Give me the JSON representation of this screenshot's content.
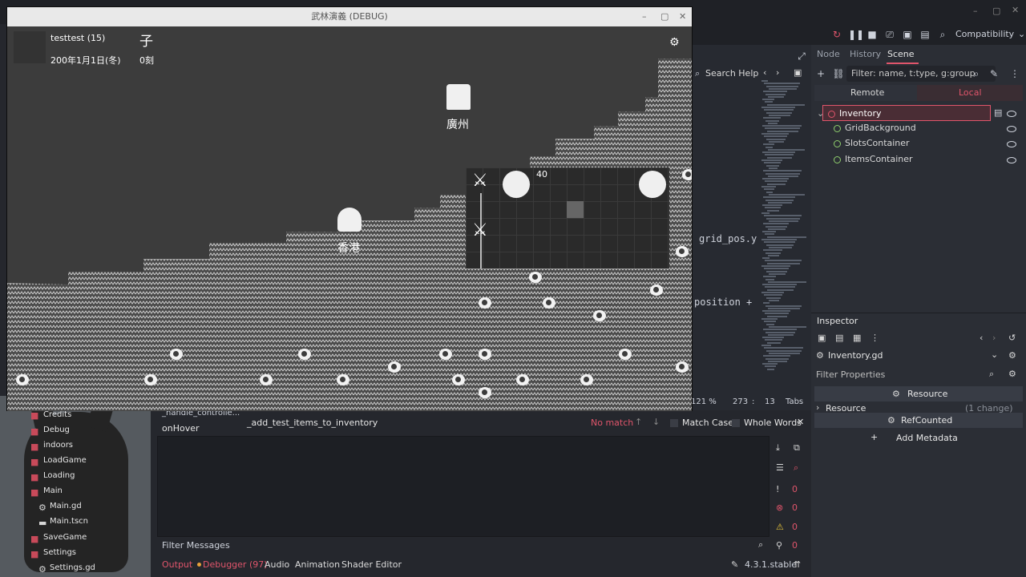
{
  "game": {
    "title": "武林演義 (DEBUG)",
    "player_name": "testtest (15)",
    "date_text": "200年1月1日(冬)",
    "hour_char": "子",
    "time_text": "0刻",
    "city_guangzhou": "廣州",
    "city_hongkong": "香港",
    "stack_count": "40"
  },
  "editor": {
    "compatibility": "Compatibility",
    "search_help": "Search Help",
    "code_line_1": "grid_pos.y",
    "code_line_2": "position +",
    "zoom": "121 %",
    "line": "273",
    "col": "13",
    "tabs": "Tabs",
    "version": "4.3.1.stable"
  },
  "scene_dock": {
    "tabs": [
      "Node",
      "History",
      "Scene"
    ],
    "filter_placeholder": "Filter: name, t:type, g:group",
    "remote": "Remote",
    "local": "Local",
    "nodes": [
      "Inventory",
      "GridBackground",
      "SlotsContainer",
      "ItemsContainer"
    ]
  },
  "inspector": {
    "title": "Inspector",
    "resource_file": "Inventory.gd",
    "filter_placeholder": "Filter Properties",
    "resource_header": "Resource",
    "resource_row": "Resource",
    "resource_change": "(1 change)",
    "refcounted": "RefCounted",
    "add_metadata": "Add Metadata"
  },
  "bottom": {
    "func_1": "_handle_controlle...",
    "func_2": "onHover",
    "search_text": "_add_test_items_to_inventory",
    "no_match": "No match",
    "match_case": "Match Case",
    "whole_words": "Whole Words",
    "filter_messages": "Filter Messages",
    "tabs": [
      "Output",
      "Debugger (97)",
      "Audio",
      "Animation",
      "Shader Editor"
    ],
    "counts": [
      "0",
      "0",
      "0",
      "0"
    ]
  },
  "filesystem": {
    "items": [
      "Credits",
      "Debug",
      "indoors",
      "LoadGame",
      "Loading",
      "Main",
      "Main.gd",
      "Main.tscn",
      "SaveGame",
      "Settings",
      "Settings.gd"
    ]
  },
  "colors": {
    "accent": "#e0556b",
    "node_green": "#8fce6d"
  }
}
